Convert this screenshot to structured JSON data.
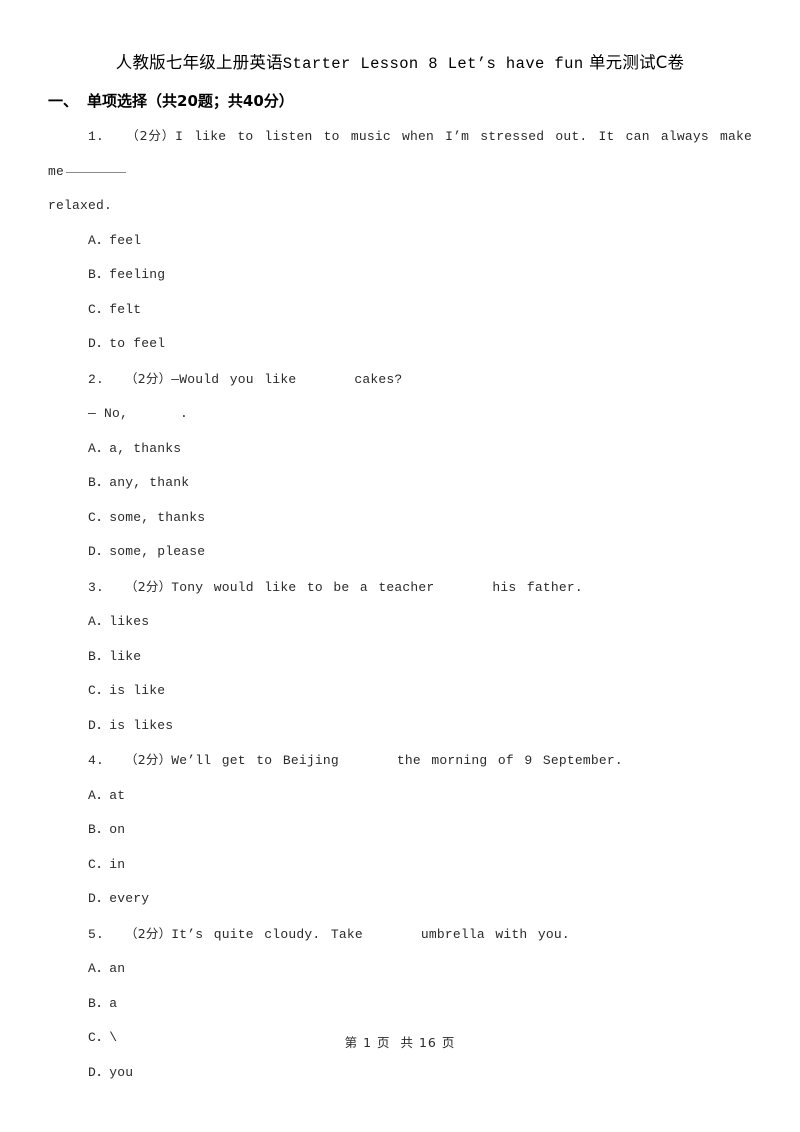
{
  "document": {
    "title_cn_prefix": "人教版七年级上册英语",
    "title_en": "Starter Lesson 8 Let’s have fun",
    "title_cn_suffix": "单元测试C卷",
    "title_full": "人教版七年级上册英语Starter Lesson 8 Let’s have fun 单元测试C卷"
  },
  "section": {
    "number": "一、",
    "name": "单项选择",
    "meta": "（共20题；共40分）",
    "full": "一、 单项选择（共20题；共40分）"
  },
  "questions": [
    {
      "number": "1.",
      "score": "（2分）",
      "stem_before": "I like to listen to music when I’m stressed out. It can always make me",
      "stem_wrap": "relaxed.",
      "has_trailing_blank": true,
      "options": [
        {
          "label": "A．",
          "text": "feel"
        },
        {
          "label": "B．",
          "text": "feeling"
        },
        {
          "label": "C．",
          "text": "felt"
        },
        {
          "label": "D．",
          "text": "to feel"
        }
      ]
    },
    {
      "number": "2.",
      "score": "（2分）",
      "stem_before": "—Would you like",
      "stem_after": "cakes?",
      "dialogue_line": "— No,",
      "dialogue_after": ".",
      "options": [
        {
          "label": "A．",
          "text": "a, thanks"
        },
        {
          "label": "B．",
          "text": "any, thank"
        },
        {
          "label": "C．",
          "text": "some, thanks"
        },
        {
          "label": "D．",
          "text": "some, please"
        }
      ]
    },
    {
      "number": "3.",
      "score": "（2分）",
      "stem_before": "Tony would like to be a teacher",
      "stem_after": "his father.",
      "options": [
        {
          "label": "A．",
          "text": "likes"
        },
        {
          "label": "B．",
          "text": "like"
        },
        {
          "label": "C．",
          "text": "is like"
        },
        {
          "label": "D．",
          "text": "is likes"
        }
      ]
    },
    {
      "number": "4.",
      "score": "（2分）",
      "stem_before": "We’ll get to Beijing",
      "stem_after": "the morning of 9 September.",
      "options": [
        {
          "label": "A．",
          "text": "at"
        },
        {
          "label": "B．",
          "text": "on"
        },
        {
          "label": "C．",
          "text": "in"
        },
        {
          "label": "D．",
          "text": "every"
        }
      ]
    },
    {
      "number": "5.",
      "score": "（2分）",
      "stem_before": "It’s quite cloudy. Take",
      "stem_after": "umbrella with you.",
      "options": [
        {
          "label": "A．",
          "text": "an"
        },
        {
          "label": "B．",
          "text": "a"
        },
        {
          "label": "C．",
          "text": "\\"
        },
        {
          "label": "D．",
          "text": "you"
        }
      ]
    }
  ],
  "footer": {
    "text": "第 1 页  共 16 页"
  }
}
